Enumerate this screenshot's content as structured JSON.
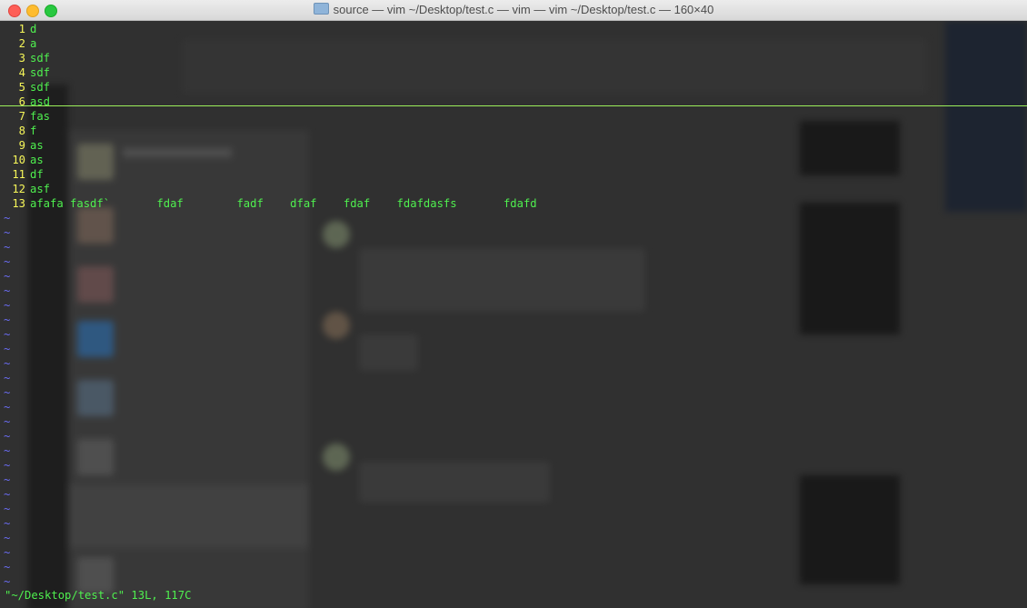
{
  "window": {
    "title": "source — vim ~/Desktop/test.c — vim — vim ~/Desktop/test.c — 160×40"
  },
  "colors": {
    "line_number": "#f6f659",
    "text": "#4ff04f",
    "tilde": "#6a6cf2",
    "cursorline": "#9cf05a"
  },
  "editor": {
    "lines": [
      {
        "num": "1",
        "text": "d"
      },
      {
        "num": "2",
        "text": "a"
      },
      {
        "num": "3",
        "text": "sdf"
      },
      {
        "num": "4",
        "text": "sdf"
      },
      {
        "num": "5",
        "text": "sdf"
      },
      {
        "num": "6",
        "text": "asd"
      },
      {
        "num": "7",
        "text": "fas"
      },
      {
        "num": "8",
        "text": "f"
      },
      {
        "num": "9",
        "text": "as"
      },
      {
        "num": "10",
        "text": "as"
      },
      {
        "num": "11",
        "text": "df"
      },
      {
        "num": "12",
        "text": "asf"
      },
      {
        "num": "13",
        "text": "afafa fasdf`       fdaf        fadf    dfaf    fdaf    fdafdasfs       fdafd"
      }
    ],
    "tilde": "~",
    "tilde_count": 26
  },
  "status_line": "\"~/Desktop/test.c\" 13L, 117C"
}
